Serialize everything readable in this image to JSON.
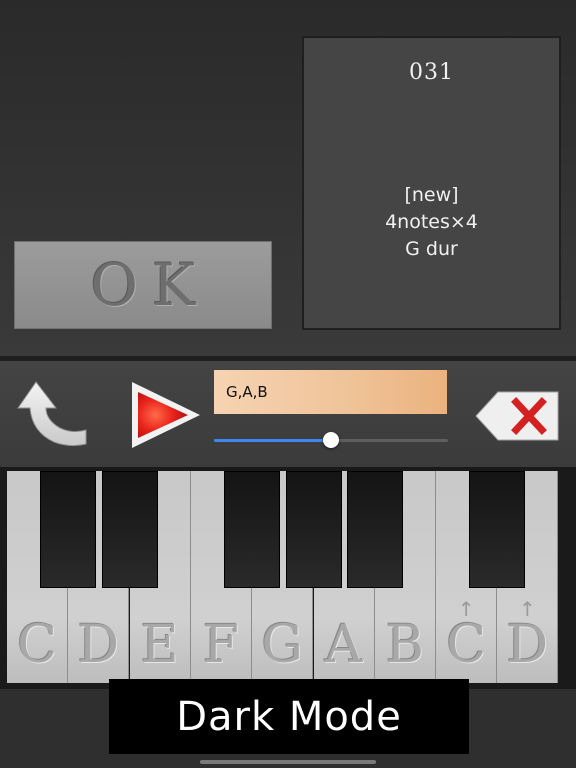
{
  "ok_button": {
    "label": "OK"
  },
  "info": {
    "number": "031",
    "lines": [
      "[new]",
      "4notes×4",
      "G dur"
    ]
  },
  "controls": {
    "back_icon": "curved-back-arrow-icon",
    "play_icon": "red-play-triangle-icon",
    "delete_icon": "backspace-x-icon",
    "note_input": "G,A,B",
    "tempo_slider_fraction": 0.5
  },
  "keyboard": {
    "white_keys": [
      {
        "label": "C",
        "octave_up": false
      },
      {
        "label": "D",
        "octave_up": false
      },
      {
        "label": "E",
        "octave_up": false
      },
      {
        "label": "F",
        "octave_up": false
      },
      {
        "label": "G",
        "octave_up": false
      },
      {
        "label": "A",
        "octave_up": false
      },
      {
        "label": "B",
        "octave_up": false
      },
      {
        "label": "C",
        "octave_up": true
      },
      {
        "label": "D",
        "octave_up": true
      }
    ],
    "octave_mark": "↑"
  },
  "banner": {
    "text": "Dark Mode"
  },
  "colors": {
    "play_red": "#e8231b",
    "delete_x": "#d42020",
    "slider_blue": "#3f86f2",
    "note_field": "#f0c49a"
  }
}
